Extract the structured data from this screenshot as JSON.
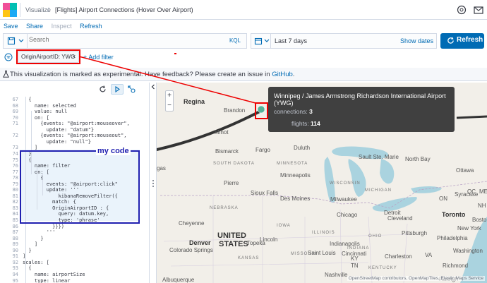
{
  "header": {
    "breadcrumb_root": "Visualize",
    "breadcrumb_sep": "/",
    "breadcrumb_current": "[Flights] Airport Connections (Hover Over Airport)"
  },
  "top_menu": {
    "save": "Save",
    "share": "Share",
    "inspect": "Inspect",
    "refresh": "Refresh"
  },
  "query": {
    "placeholder": "Search",
    "language": "KQL"
  },
  "date": {
    "range": "Last 7 days",
    "show_dates": "Show dates"
  },
  "refresh_button": "Refresh",
  "filter": {
    "pill_label": "OriginAirportID: YWG",
    "remove": "×",
    "add_filter": "+ Add filter"
  },
  "banner": {
    "text": "This visualization is marked as experimental. Have feedback? Please create an issue in ",
    "link": "GitHub",
    "suffix": "."
  },
  "annotation": {
    "my_code": "my code"
  },
  "editor": {
    "lines": [
      {
        "n": "67",
        "t": "  {"
      },
      {
        "n": "68",
        "t": "    name: selected"
      },
      {
        "n": "69",
        "t": "    value: null"
      },
      {
        "n": "70",
        "t": "    on: ["
      },
      {
        "n": "71",
        "t": "      {events: \"@airport:mouseover\","
      },
      {
        "n": "",
        "t": "        update: \"datum\"}"
      },
      {
        "n": "72",
        "t": "      {events: \"@airport:mouseout\","
      },
      {
        "n": "",
        "t": "        update: \"null\"}"
      },
      {
        "n": "73",
        "t": "    ]"
      },
      {
        "n": "74",
        "t": "  }"
      },
      {
        "n": "75",
        "t": "  {"
      },
      {
        "n": "76",
        "t": "    name: filter"
      },
      {
        "n": "77",
        "t": "    on: ["
      },
      {
        "n": "78",
        "t": "      {"
      },
      {
        "n": "79",
        "t": "        events: \"@airport:click\""
      },
      {
        "n": "80",
        "t": "        update: '''"
      },
      {
        "n": "81",
        "t": "            kibanaRemoveFilter({"
      },
      {
        "n": "82",
        "t": "          match: {"
      },
      {
        "n": "83",
        "t": "          OriginAirportID : {"
      },
      {
        "n": "84",
        "t": "            query: datum.key,"
      },
      {
        "n": "85",
        "t": "            type: 'phrase'"
      },
      {
        "n": "86",
        "t": "          }}})"
      },
      {
        "n": "87",
        "t": "        '''"
      },
      {
        "n": "88",
        "t": "      }"
      },
      {
        "n": "89",
        "t": "    ]"
      },
      {
        "n": "90",
        "t": "  }"
      },
      {
        "n": "91",
        "t": "]"
      },
      {
        "n": "92",
        "t": "scales: ["
      },
      {
        "n": "93",
        "t": "  {"
      },
      {
        "n": "94",
        "t": "    name: airportSize"
      },
      {
        "n": "95",
        "t": "    type: linear"
      },
      {
        "n": "96",
        "t": "    domain: {data: \"table\", field:"
      },
      {
        "n": "",
        "t": "      \"doc_count\"}"
      }
    ]
  },
  "tooltip": {
    "title": "Winnipeg / James Armstrong Richardson International Airport (YWG)",
    "connections_label": "connections:",
    "connections_value": "3",
    "flights_label": "flights:",
    "flights_value": "114"
  },
  "map": {
    "attribution": "OpenStreetMap contributors, OpenMapTiles, Elastic Maps Service",
    "country": [
      "UNITED",
      "STATES"
    ],
    "cities": [
      {
        "name": "Regina",
        "big": true
      },
      {
        "name": "Brandon",
        "big": false
      },
      {
        "name": "Minot",
        "big": false
      },
      {
        "name": "Bismarck",
        "big": false
      },
      {
        "name": "Fargo",
        "big": false
      },
      {
        "name": "Duluth",
        "big": false
      },
      {
        "name": "Sault Ste. Marie",
        "big": false
      },
      {
        "name": "North Bay",
        "big": false
      },
      {
        "name": "Ottawa",
        "big": false
      },
      {
        "name": "Minneapolis",
        "big": false
      },
      {
        "name": "Toronto",
        "big": true
      },
      {
        "name": "Pierre",
        "big": false
      },
      {
        "name": "Sioux Falls",
        "big": false
      },
      {
        "name": "Milwaukee",
        "big": false
      },
      {
        "name": "Detroit",
        "big": false
      },
      {
        "name": "Syracuse",
        "big": false
      },
      {
        "name": "Chicago",
        "big": false
      },
      {
        "name": "Cleveland",
        "big": false
      },
      {
        "name": "Des Moines",
        "big": false
      },
      {
        "name": "Boston",
        "big": false
      },
      {
        "name": "Cheyenne",
        "big": false
      },
      {
        "name": "Lincoln",
        "big": false
      },
      {
        "name": "Pittsburgh",
        "big": false
      },
      {
        "name": "New York",
        "big": false
      },
      {
        "name": "Indianapolis",
        "big": false
      },
      {
        "name": "Denver",
        "big": true
      },
      {
        "name": "Topeka",
        "big": false
      },
      {
        "name": "Philadelphia",
        "big": false
      },
      {
        "name": "Colorado Springs",
        "big": false
      },
      {
        "name": "Cincinnati",
        "big": false
      },
      {
        "name": "Washington",
        "big": false
      },
      {
        "name": "Saint Louis",
        "big": false
      },
      {
        "name": "Charleston",
        "big": false
      },
      {
        "name": "Richmond",
        "big": false
      },
      {
        "name": "Albuquerque",
        "big": false
      },
      {
        "name": "Nashville",
        "big": false
      },
      {
        "name": "Raleigh",
        "big": false
      },
      {
        "name": "ON",
        "big": false
      },
      {
        "name": "QC",
        "big": false
      },
      {
        "name": "ME",
        "big": false
      },
      {
        "name": "NH",
        "big": false
      },
      {
        "name": "VA",
        "big": false
      },
      {
        "name": "TN",
        "big": false
      },
      {
        "name": "KY",
        "big": false
      },
      {
        "name": "gas",
        "big": false
      }
    ],
    "states": [
      "MINNESOTA",
      "WISCONSIN",
      "IOWA",
      "ILLINOIS",
      "MICHIGAN",
      "OHIO",
      "MISSOURI",
      "KANSAS",
      "SOUTH DAKOTA",
      "NEBRASKA",
      "INDIANA",
      "KENTUCKY"
    ]
  }
}
